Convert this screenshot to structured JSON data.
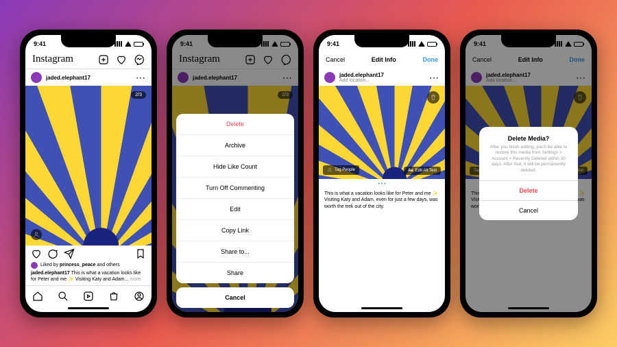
{
  "status": {
    "time": "9:41"
  },
  "feed": {
    "logo": "Instagram",
    "username": "jaded.elephant17",
    "counter": "2/3",
    "likes_prefix": "Liked by ",
    "likes_bold": "princess_peace",
    "likes_suffix": " and others",
    "caption_user": "jaded.elephant17",
    "caption_text": " This is what a vacation looks like for Peter and me ✨ Visiting Katy and Adam... ",
    "more": "more"
  },
  "sheet": {
    "items": [
      "Delete",
      "Archive",
      "Hide Like Count",
      "Turn Off Commenting",
      "Edit",
      "Copy Link",
      "Share to...",
      "Share"
    ],
    "cancel": "Cancel"
  },
  "edit": {
    "cancel": "Cancel",
    "title": "Edit Info",
    "done": "Done",
    "add_location": "Add location...",
    "tag_people": "Tag People",
    "alt_prefix": "Aa ",
    "alt_text": "Edit Alt Text",
    "caption": "This is what a vacation looks like for Peter and me ✨ Visiting Katy and Adam, even for just a few days, was worth the trek out of the city."
  },
  "dialog": {
    "title": "Delete Media?",
    "body": "After you finish editing, you'll be able to restore this media from Settings > Account > Recently Deleted within 30 days. After that, it will be permanently deleted.",
    "delete": "Delete",
    "cancel": "Cancel"
  }
}
